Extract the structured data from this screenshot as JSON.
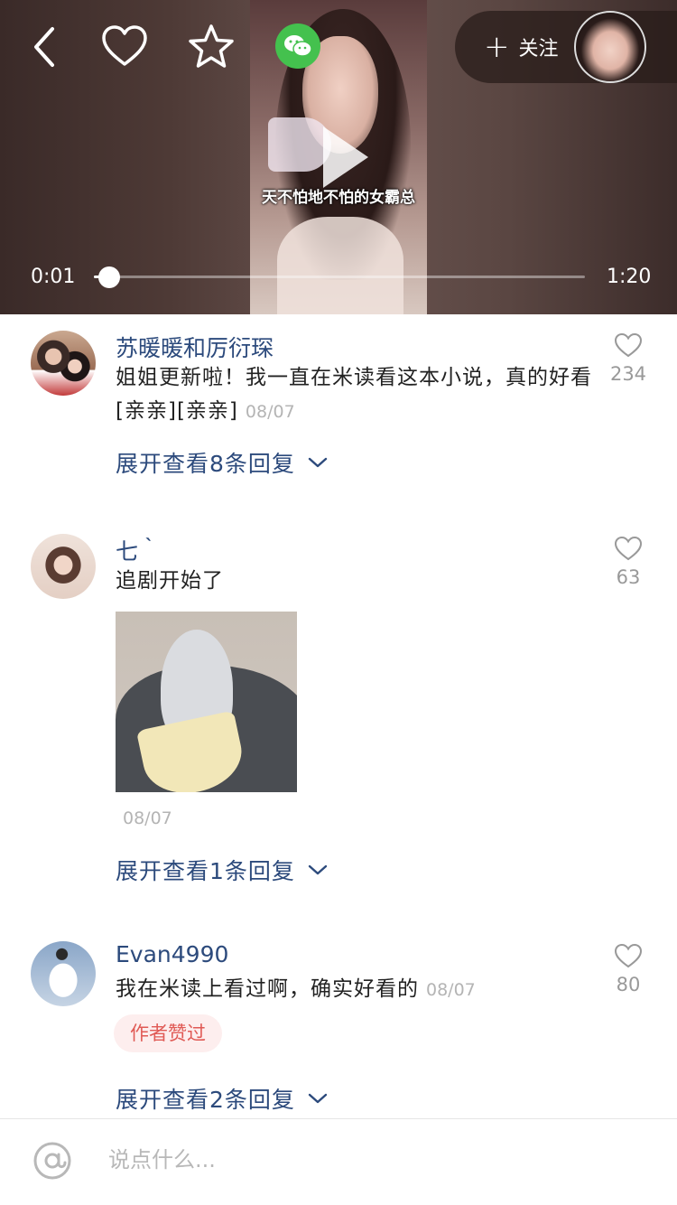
{
  "player": {
    "subtitle": "天不怕地不怕的女霸总",
    "current_time": "0:01",
    "total_time": "1:20",
    "progress": 0.0125,
    "follow_label": "关注",
    "icons": [
      "back-icon",
      "heart-icon",
      "star-icon",
      "wechat-icon",
      "plus-icon",
      "play-icon"
    ]
  },
  "comments": [
    {
      "username": "苏暖暖和厉衍琛",
      "text": "姐姐更新啦！我一直在米读看这本小说，真的好看[亲亲][亲亲]",
      "date": "08/07",
      "likes": "234",
      "expand": "展开查看8条回复"
    },
    {
      "username": "七｀",
      "text": "追剧开始了",
      "date": "08/07",
      "likes": "63",
      "expand": "展开查看1条回复"
    },
    {
      "username": "Evan4990",
      "text": "我在米读上看过啊，确实好看的",
      "date": "08/07",
      "likes": "80",
      "badge": "作者赞过",
      "expand": "展开查看2条回复"
    }
  ],
  "input": {
    "placeholder": "说点什么..."
  },
  "colors": {
    "link_blue": "#2c4a7c",
    "badge_bg": "#fdeeee",
    "badge_text": "#e05a55",
    "wechat_green": "#44c14e"
  }
}
